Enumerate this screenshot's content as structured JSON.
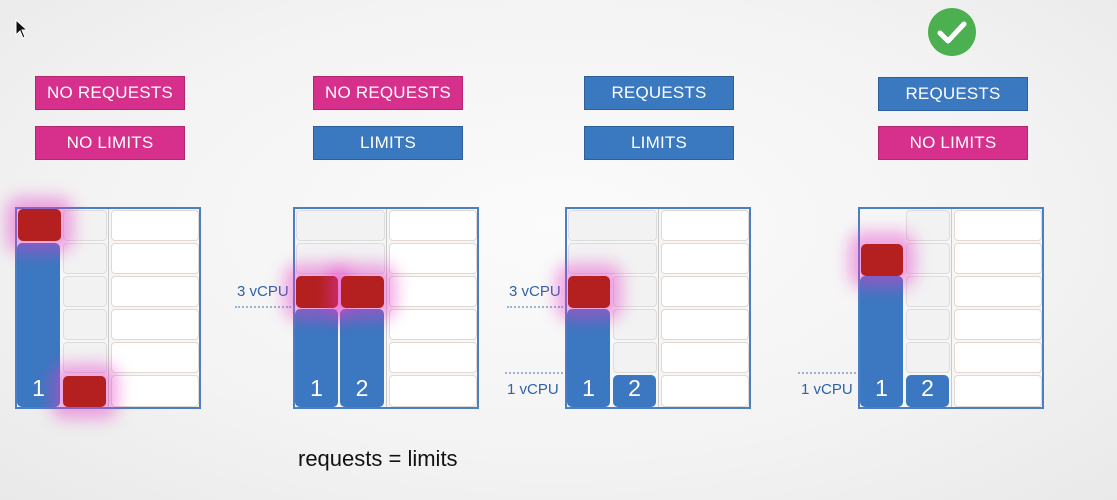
{
  "panels": [
    {
      "tags": [
        "NO REQUESTS",
        "NO LIMITS"
      ],
      "tag_colors": [
        "pink",
        "pink"
      ],
      "labels": {
        "upper": "",
        "lower": ""
      },
      "block_labels": [
        "1",
        ""
      ]
    },
    {
      "tags": [
        "NO REQUESTS",
        "LIMITS"
      ],
      "tag_colors": [
        "pink",
        "blue"
      ],
      "labels": {
        "upper": "3 vCPU",
        "lower": ""
      },
      "block_labels": [
        "1",
        "2"
      ]
    },
    {
      "tags": [
        "REQUESTS",
        "LIMITS"
      ],
      "tag_colors": [
        "blue",
        "blue"
      ],
      "labels": {
        "upper": "3 vCPU",
        "lower": "1 vCPU"
      },
      "block_labels": [
        "1",
        "2"
      ]
    },
    {
      "tags": [
        "REQUESTS",
        "NO LIMITS"
      ],
      "tag_colors": [
        "blue",
        "pink"
      ],
      "labels": {
        "upper": "",
        "lower": "1 vCPU"
      },
      "block_labels": [
        "1",
        "2"
      ],
      "approved": true
    }
  ],
  "caption": "requests = limits",
  "colors": {
    "pink": "#d62f8c",
    "blue": "#3a78c0",
    "hot": "#b3201f",
    "check": "#4caf50"
  },
  "icons": [
    "cursor-icon",
    "checkmark-icon"
  ]
}
